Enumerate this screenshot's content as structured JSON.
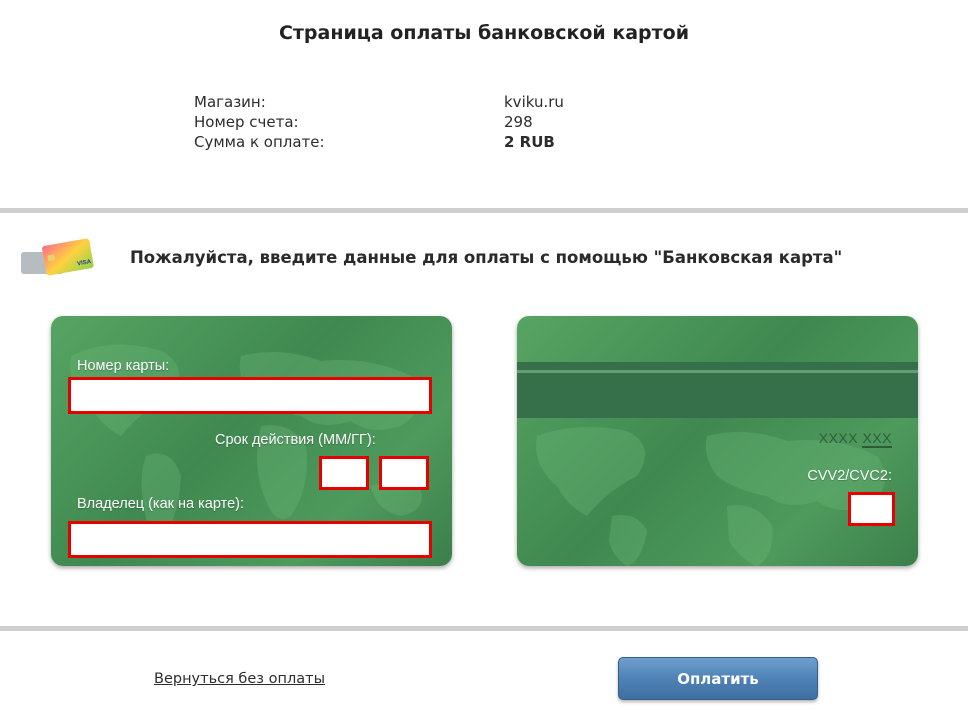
{
  "page": {
    "title": "Страница оплаты банковской картой"
  },
  "order": {
    "shop_label": "Магазин:",
    "shop_value": "kviku.ru",
    "invoice_label": "Номер счета:",
    "invoice_value": "298",
    "amount_label": "Сумма к оплате:",
    "amount_value": "2 RUB"
  },
  "method": {
    "icon": "bank-card-icon",
    "icon_text": "VISA",
    "title": "Пожалуйста, введите данные для оплаты с помощью \"Банковская карта\""
  },
  "card_front": {
    "number_label": "Номер карты:",
    "number_value": "",
    "expiry_label": "Срок действия (ММ/ГГ):",
    "expiry_month": "",
    "expiry_year": "",
    "holder_label": "Владелец (как на карте):",
    "holder_value": ""
  },
  "card_back": {
    "masked_prefix": "XXXX",
    "masked_suffix": "XXX",
    "cvv_label": "CVV2/CVC2:",
    "cvv_value": ""
  },
  "actions": {
    "back_label": "Вернуться без оплаты",
    "pay_label": "Оплатить"
  },
  "colors": {
    "card_green": "#4e9a5c",
    "error_border": "#e60000",
    "button_blue": "#4f82b6"
  }
}
